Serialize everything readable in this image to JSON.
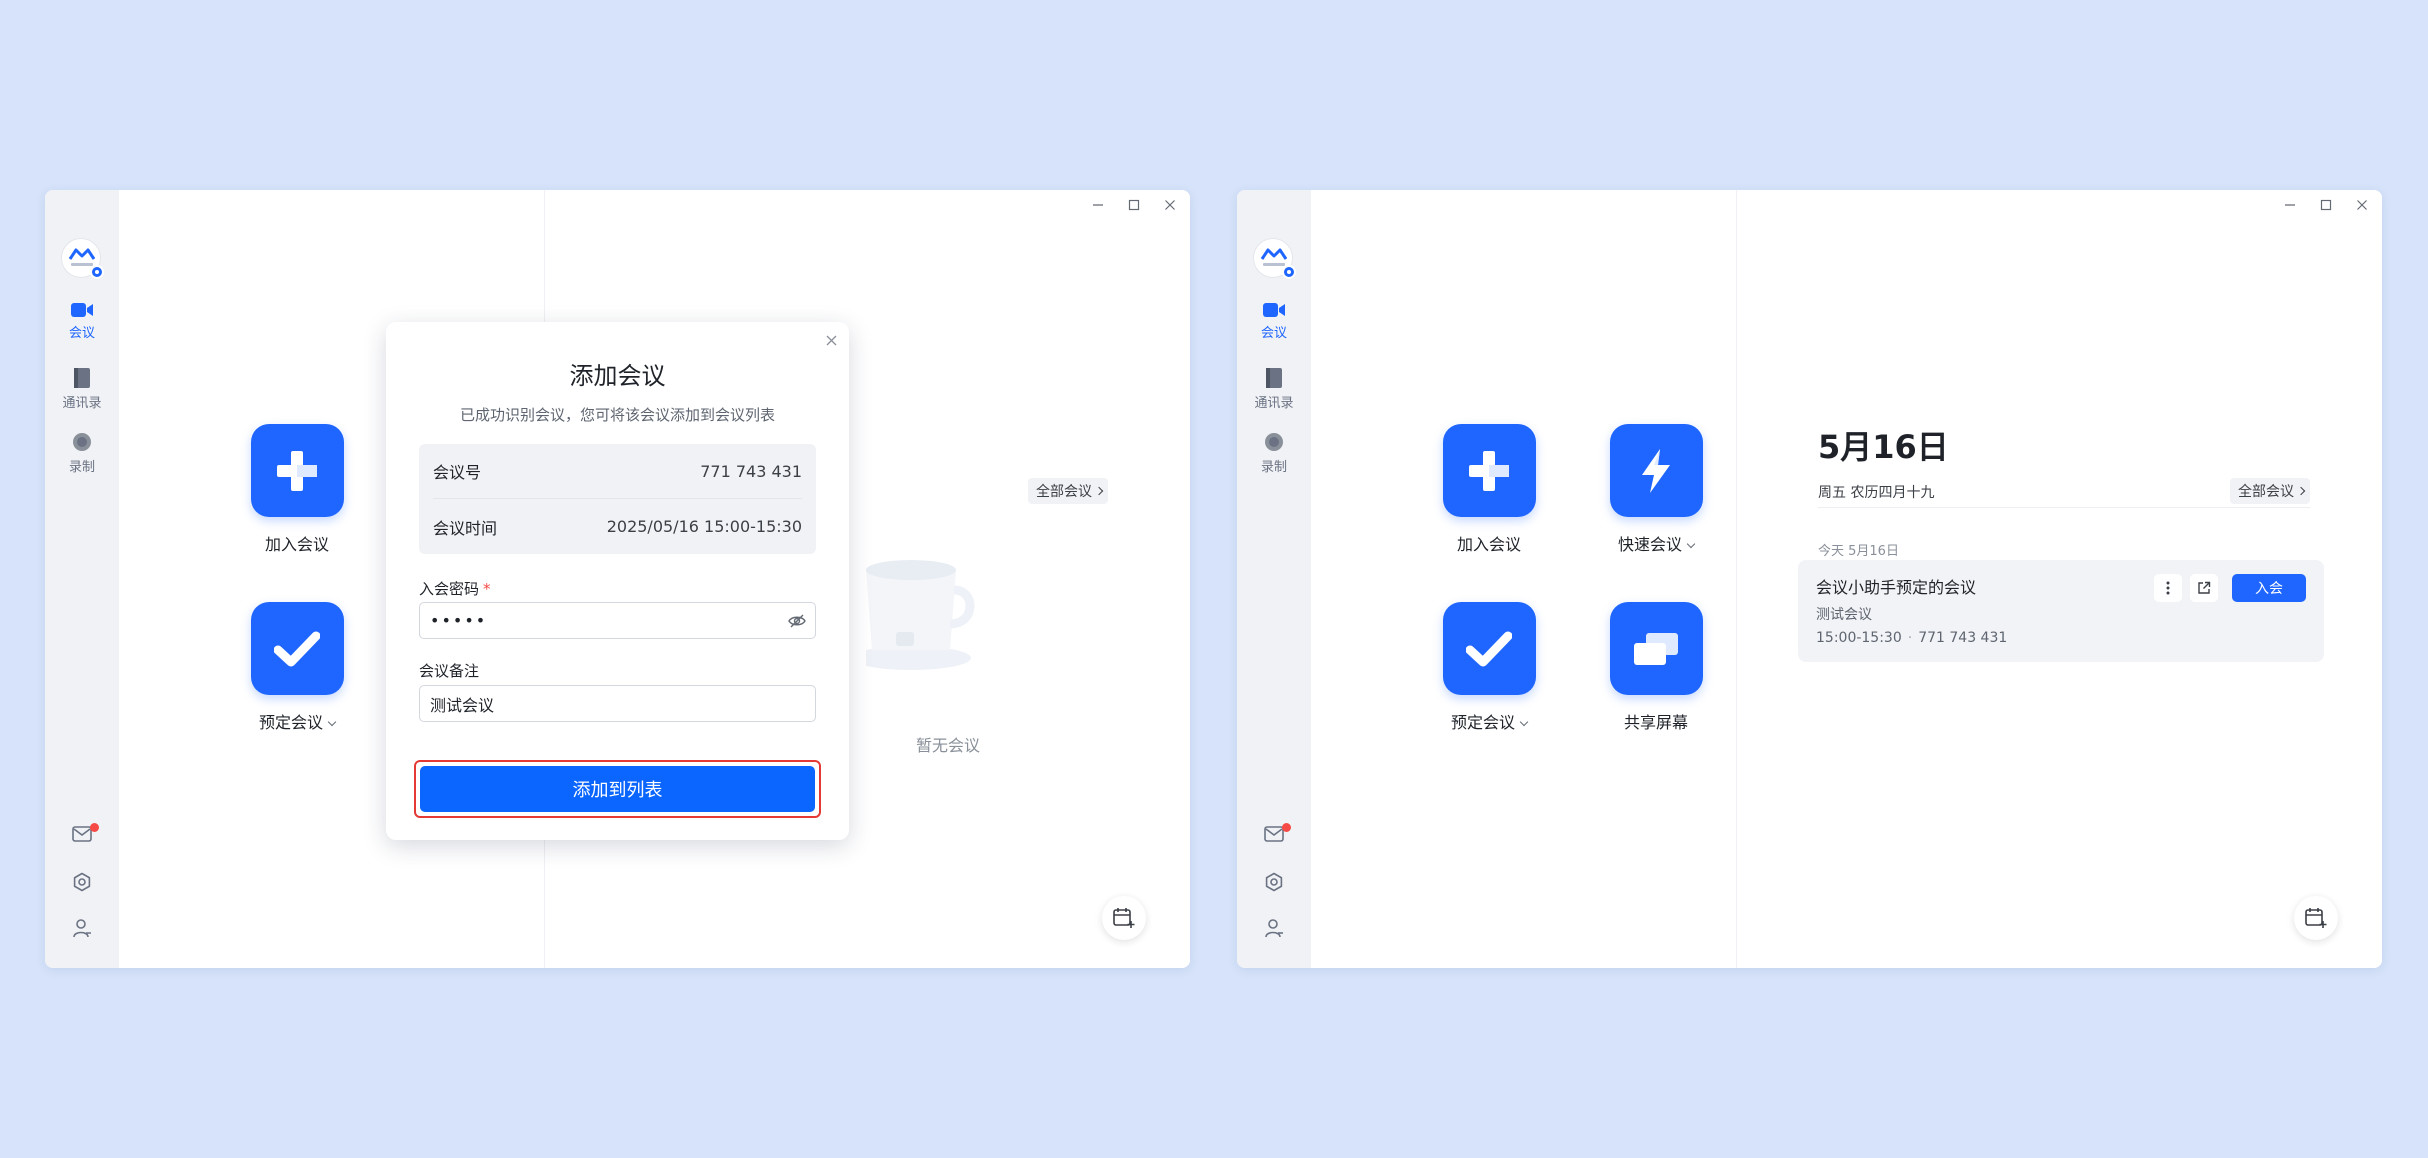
{
  "sidebar": {
    "items": [
      {
        "label": "会议",
        "icon": "video-camera-icon"
      },
      {
        "label": "通讯录",
        "icon": "contacts-book-icon"
      },
      {
        "label": "录制",
        "icon": "record-icon"
      }
    ]
  },
  "actions": {
    "join": "加入会议",
    "quick": "快速会议",
    "schedule": "预定会议",
    "share": "共享屏幕"
  },
  "left_window": {
    "all_meetings": "全部会议",
    "empty_text": "暂无会议",
    "dialog": {
      "title": "添加会议",
      "description": "已成功识别会议，您可将该会议添加到会议列表",
      "meeting_id_label": "会议号",
      "meeting_id": "771 743 431",
      "meeting_time_label": "会议时间",
      "meeting_time": "2025/05/16 15:00-15:30",
      "password_label": "入会密码",
      "password_value": "•••••",
      "note_label": "会议备注",
      "note_value": "测试会议",
      "submit": "添加到列表"
    }
  },
  "right_window": {
    "date_title": "5月16日",
    "lunar": "周五 农历四月十九",
    "all_meetings": "全部会议",
    "today_label": "今天 5月16日",
    "meeting": {
      "title": "会议小助手预定的会议",
      "note": "测试会议",
      "time": "15:00-15:30",
      "id": "771 743 431",
      "join": "入会"
    }
  },
  "colors": {
    "background": "#d6e3fa",
    "accent": "#1e66ff",
    "highlight_border": "#e53935",
    "sidebar": "#f1f2f5"
  }
}
